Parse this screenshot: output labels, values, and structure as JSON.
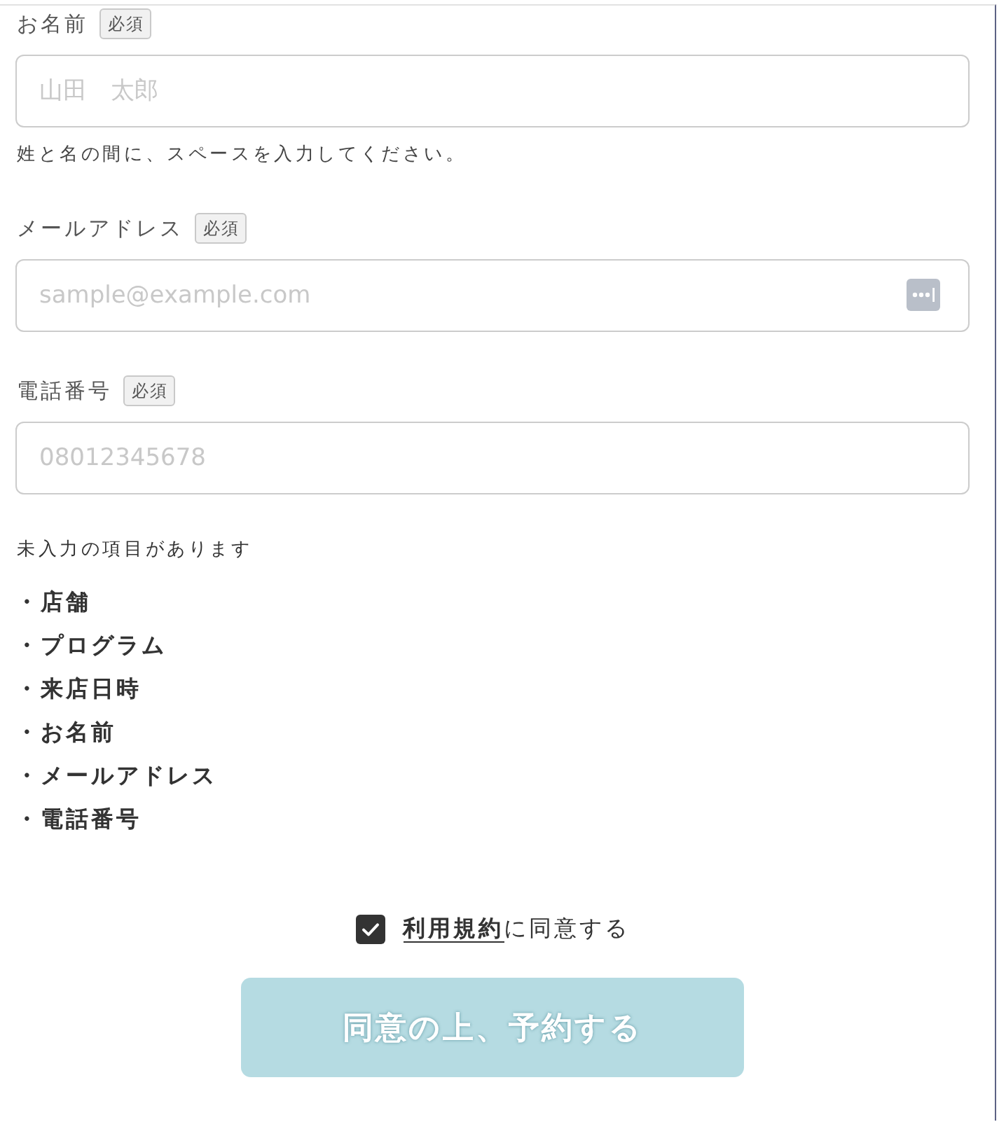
{
  "fields": [
    {
      "label": "お名前",
      "badge": "必須",
      "placeholder": "山田　太郎",
      "hint": "姓と名の間に、スペースを入力してください。",
      "autofill_button": false
    },
    {
      "label": "メールアドレス",
      "badge": "必須",
      "placeholder": "sample@example.com",
      "autofill_button": true
    },
    {
      "label": "電話番号",
      "badge": "必須",
      "placeholder": "08012345678",
      "autofill_button": false
    }
  ],
  "missing": {
    "message": "未入力の項目があります",
    "items": [
      "・店舗",
      "・プログラム",
      "・来店日時",
      "・お名前",
      "・メールアドレス",
      "・電話番号"
    ]
  },
  "agreement": {
    "checked": true,
    "link": "利用規約",
    "text": "に同意する"
  },
  "submit": {
    "label": "同意の上、予約する",
    "disabled": true
  }
}
